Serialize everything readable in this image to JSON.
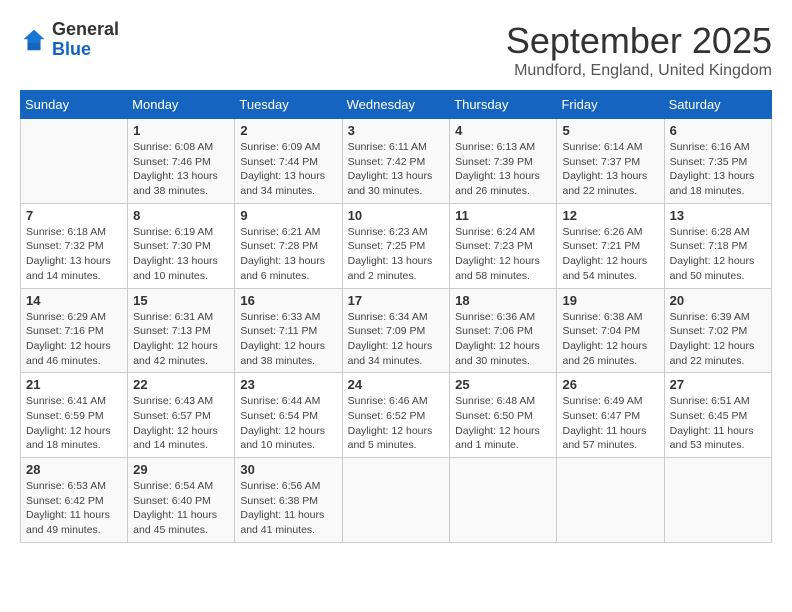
{
  "logo": {
    "general": "General",
    "blue": "Blue"
  },
  "header": {
    "month": "September 2025",
    "location": "Mundford, England, United Kingdom"
  },
  "days_of_week": [
    "Sunday",
    "Monday",
    "Tuesday",
    "Wednesday",
    "Thursday",
    "Friday",
    "Saturday"
  ],
  "weeks": [
    [
      {
        "day": "",
        "info": ""
      },
      {
        "day": "1",
        "info": "Sunrise: 6:08 AM\nSunset: 7:46 PM\nDaylight: 13 hours\nand 38 minutes."
      },
      {
        "day": "2",
        "info": "Sunrise: 6:09 AM\nSunset: 7:44 PM\nDaylight: 13 hours\nand 34 minutes."
      },
      {
        "day": "3",
        "info": "Sunrise: 6:11 AM\nSunset: 7:42 PM\nDaylight: 13 hours\nand 30 minutes."
      },
      {
        "day": "4",
        "info": "Sunrise: 6:13 AM\nSunset: 7:39 PM\nDaylight: 13 hours\nand 26 minutes."
      },
      {
        "day": "5",
        "info": "Sunrise: 6:14 AM\nSunset: 7:37 PM\nDaylight: 13 hours\nand 22 minutes."
      },
      {
        "day": "6",
        "info": "Sunrise: 6:16 AM\nSunset: 7:35 PM\nDaylight: 13 hours\nand 18 minutes."
      }
    ],
    [
      {
        "day": "7",
        "info": "Sunrise: 6:18 AM\nSunset: 7:32 PM\nDaylight: 13 hours\nand 14 minutes."
      },
      {
        "day": "8",
        "info": "Sunrise: 6:19 AM\nSunset: 7:30 PM\nDaylight: 13 hours\nand 10 minutes."
      },
      {
        "day": "9",
        "info": "Sunrise: 6:21 AM\nSunset: 7:28 PM\nDaylight: 13 hours\nand 6 minutes."
      },
      {
        "day": "10",
        "info": "Sunrise: 6:23 AM\nSunset: 7:25 PM\nDaylight: 13 hours\nand 2 minutes."
      },
      {
        "day": "11",
        "info": "Sunrise: 6:24 AM\nSunset: 7:23 PM\nDaylight: 12 hours\nand 58 minutes."
      },
      {
        "day": "12",
        "info": "Sunrise: 6:26 AM\nSunset: 7:21 PM\nDaylight: 12 hours\nand 54 minutes."
      },
      {
        "day": "13",
        "info": "Sunrise: 6:28 AM\nSunset: 7:18 PM\nDaylight: 12 hours\nand 50 minutes."
      }
    ],
    [
      {
        "day": "14",
        "info": "Sunrise: 6:29 AM\nSunset: 7:16 PM\nDaylight: 12 hours\nand 46 minutes."
      },
      {
        "day": "15",
        "info": "Sunrise: 6:31 AM\nSunset: 7:13 PM\nDaylight: 12 hours\nand 42 minutes."
      },
      {
        "day": "16",
        "info": "Sunrise: 6:33 AM\nSunset: 7:11 PM\nDaylight: 12 hours\nand 38 minutes."
      },
      {
        "day": "17",
        "info": "Sunrise: 6:34 AM\nSunset: 7:09 PM\nDaylight: 12 hours\nand 34 minutes."
      },
      {
        "day": "18",
        "info": "Sunrise: 6:36 AM\nSunset: 7:06 PM\nDaylight: 12 hours\nand 30 minutes."
      },
      {
        "day": "19",
        "info": "Sunrise: 6:38 AM\nSunset: 7:04 PM\nDaylight: 12 hours\nand 26 minutes."
      },
      {
        "day": "20",
        "info": "Sunrise: 6:39 AM\nSunset: 7:02 PM\nDaylight: 12 hours\nand 22 minutes."
      }
    ],
    [
      {
        "day": "21",
        "info": "Sunrise: 6:41 AM\nSunset: 6:59 PM\nDaylight: 12 hours\nand 18 minutes."
      },
      {
        "day": "22",
        "info": "Sunrise: 6:43 AM\nSunset: 6:57 PM\nDaylight: 12 hours\nand 14 minutes."
      },
      {
        "day": "23",
        "info": "Sunrise: 6:44 AM\nSunset: 6:54 PM\nDaylight: 12 hours\nand 10 minutes."
      },
      {
        "day": "24",
        "info": "Sunrise: 6:46 AM\nSunset: 6:52 PM\nDaylight: 12 hours\nand 5 minutes."
      },
      {
        "day": "25",
        "info": "Sunrise: 6:48 AM\nSunset: 6:50 PM\nDaylight: 12 hours\nand 1 minute."
      },
      {
        "day": "26",
        "info": "Sunrise: 6:49 AM\nSunset: 6:47 PM\nDaylight: 11 hours\nand 57 minutes."
      },
      {
        "day": "27",
        "info": "Sunrise: 6:51 AM\nSunset: 6:45 PM\nDaylight: 11 hours\nand 53 minutes."
      }
    ],
    [
      {
        "day": "28",
        "info": "Sunrise: 6:53 AM\nSunset: 6:42 PM\nDaylight: 11 hours\nand 49 minutes."
      },
      {
        "day": "29",
        "info": "Sunrise: 6:54 AM\nSunset: 6:40 PM\nDaylight: 11 hours\nand 45 minutes."
      },
      {
        "day": "30",
        "info": "Sunrise: 6:56 AM\nSunset: 6:38 PM\nDaylight: 11 hours\nand 41 minutes."
      },
      {
        "day": "",
        "info": ""
      },
      {
        "day": "",
        "info": ""
      },
      {
        "day": "",
        "info": ""
      },
      {
        "day": "",
        "info": ""
      }
    ]
  ]
}
